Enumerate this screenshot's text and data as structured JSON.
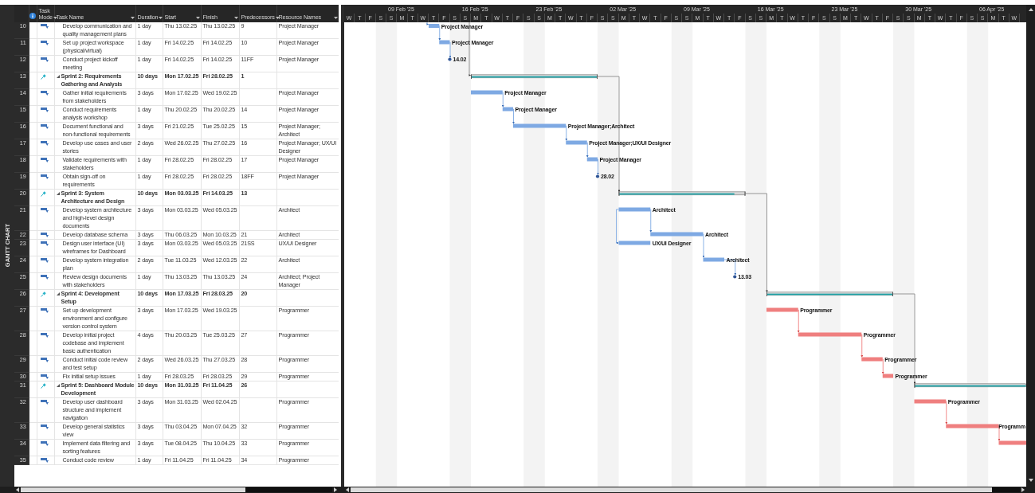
{
  "view_bar": {
    "label": "GANTT CHART"
  },
  "columns": [
    {
      "kind": "info"
    },
    {
      "kind": "text",
      "label": "Task Mode"
    },
    {
      "kind": "text",
      "label": "Task Name"
    },
    {
      "kind": "text",
      "label": "Duration"
    },
    {
      "kind": "text",
      "label": "Start"
    },
    {
      "kind": "text",
      "label": "Finish"
    },
    {
      "kind": "text",
      "label": "Predecessors"
    },
    {
      "kind": "text",
      "label": "Resource Names"
    }
  ],
  "timeline": {
    "weeks": [
      "09 Feb '25",
      "16 Feb '25",
      "23 Feb '25",
      "02 Mar '25",
      "09 Mar '25",
      "16 Mar '25",
      "23 Mar '25",
      "30 Mar '25",
      "06 Apr '25"
    ],
    "days": [
      {
        "letter": "W",
        "weekend": false
      },
      {
        "letter": "T",
        "weekend": false
      },
      {
        "letter": "F",
        "weekend": false
      },
      {
        "letter": "S",
        "weekend": true
      },
      {
        "letter": "S",
        "weekend": true
      },
      {
        "letter": "M",
        "weekend": false
      },
      {
        "letter": "T",
        "weekend": false
      },
      {
        "letter": "W",
        "weekend": false
      },
      {
        "letter": "T",
        "weekend": false
      },
      {
        "letter": "F",
        "weekend": false
      },
      {
        "letter": "S",
        "weekend": true
      },
      {
        "letter": "S",
        "weekend": true
      },
      {
        "letter": "M",
        "weekend": false
      },
      {
        "letter": "T",
        "weekend": false
      },
      {
        "letter": "W",
        "weekend": false
      },
      {
        "letter": "T",
        "weekend": false
      },
      {
        "letter": "F",
        "weekend": false
      },
      {
        "letter": "S",
        "weekend": true
      },
      {
        "letter": "S",
        "weekend": true
      },
      {
        "letter": "M",
        "weekend": false
      },
      {
        "letter": "T",
        "weekend": false
      },
      {
        "letter": "W",
        "weekend": false
      },
      {
        "letter": "T",
        "weekend": false
      },
      {
        "letter": "F",
        "weekend": false
      },
      {
        "letter": "S",
        "weekend": true
      },
      {
        "letter": "S",
        "weekend": true
      },
      {
        "letter": "M",
        "weekend": false
      },
      {
        "letter": "T",
        "weekend": false
      },
      {
        "letter": "W",
        "weekend": false
      },
      {
        "letter": "T",
        "weekend": false
      },
      {
        "letter": "F",
        "weekend": false
      },
      {
        "letter": "S",
        "weekend": true
      },
      {
        "letter": "S",
        "weekend": true
      },
      {
        "letter": "M",
        "weekend": false
      },
      {
        "letter": "T",
        "weekend": false
      },
      {
        "letter": "W",
        "weekend": false
      },
      {
        "letter": "T",
        "weekend": false
      },
      {
        "letter": "F",
        "weekend": false
      },
      {
        "letter": "S",
        "weekend": true
      },
      {
        "letter": "S",
        "weekend": true
      },
      {
        "letter": "M",
        "weekend": false
      },
      {
        "letter": "T",
        "weekend": false
      },
      {
        "letter": "W",
        "weekend": false
      },
      {
        "letter": "T",
        "weekend": false
      },
      {
        "letter": "F",
        "weekend": false
      },
      {
        "letter": "S",
        "weekend": true
      },
      {
        "letter": "S",
        "weekend": true
      },
      {
        "letter": "M",
        "weekend": false
      },
      {
        "letter": "T",
        "weekend": false
      },
      {
        "letter": "W",
        "weekend": false
      },
      {
        "letter": "T",
        "weekend": false
      },
      {
        "letter": "F",
        "weekend": false
      },
      {
        "letter": "S",
        "weekend": true
      },
      {
        "letter": "S",
        "weekend": true
      },
      {
        "letter": "M",
        "weekend": false
      },
      {
        "letter": "T",
        "weekend": false
      },
      {
        "letter": "W",
        "weekend": false
      },
      {
        "letter": "T",
        "weekend": false
      },
      {
        "letter": "F",
        "weekend": false
      },
      {
        "letter": "S",
        "weekend": true
      },
      {
        "letter": "S",
        "weekend": true
      },
      {
        "letter": "M",
        "weekend": false
      },
      {
        "letter": "T",
        "weekend": false
      },
      {
        "letter": "W",
        "weekend": false
      }
    ]
  },
  "rows": [
    {
      "id": "10",
      "kind": "task",
      "name": "Develop communication and quality management plans",
      "duration": "1 day",
      "start": "Thu 13.02.25",
      "finish": "Thu 13.02.25",
      "predecessors": "9",
      "resources": "Project Manager",
      "bar": {
        "kind": "task",
        "critical": false,
        "label": "Project Manager"
      }
    },
    {
      "id": "11",
      "kind": "task",
      "name": "Set up project workspace (physical/virtual)",
      "duration": "1 day",
      "start": "Fri 14.02.25",
      "finish": "Fri 14.02.25",
      "predecessors": "10",
      "resources": "Project Manager",
      "bar": {
        "kind": "task",
        "critical": false,
        "label": "Project Manager"
      }
    },
    {
      "id": "12",
      "kind": "task",
      "name": "Conduct project kickoff meeting",
      "duration": "1 day",
      "start": "Fri 14.02.25",
      "finish": "Fri 14.02.25",
      "predecessors": "11FF",
      "resources": "Project Manager",
      "bar": {
        "kind": "milestone",
        "label": "14.02"
      }
    },
    {
      "id": "13",
      "kind": "summary",
      "expanded": true,
      "name": "Sprint 2: Requirements Gathering and Analysis",
      "duration": "10 days",
      "start": "Mon 17.02.25",
      "finish": "Fri 28.02.25",
      "predecessors": "1",
      "bar": {
        "kind": "summary"
      }
    },
    {
      "id": "14",
      "kind": "task",
      "name": "Gather initial requirements from stakeholders",
      "duration": "3 days",
      "start": "Mon 17.02.25",
      "finish": "Wed 19.02.25",
      "resources": "Project Manager",
      "bar": {
        "kind": "task",
        "critical": false,
        "label": "Project Manager"
      }
    },
    {
      "id": "15",
      "kind": "task",
      "name": "Conduct requirements analysis workshop",
      "duration": "1 day",
      "start": "Thu 20.02.25",
      "finish": "Thu 20.02.25",
      "predecessors": "14",
      "resources": "Project Manager",
      "bar": {
        "kind": "task",
        "critical": false,
        "label": "Project Manager"
      }
    },
    {
      "id": "16",
      "kind": "task",
      "name": "Document functional and non-functional requirements",
      "duration": "3 days",
      "start": "Fri 21.02.25",
      "finish": "Tue 25.02.25",
      "predecessors": "15",
      "resources": "Project Manager; Architect",
      "bar": {
        "kind": "task",
        "critical": false,
        "label": "Project Manager;Architect"
      }
    },
    {
      "id": "17",
      "kind": "task",
      "name": "Develop use cases and user stories",
      "duration": "2 days",
      "start": "Wed 26.02.25",
      "finish": "Thu 27.02.25",
      "predecessors": "16",
      "resources": "Project Manager; UX/UI Designer",
      "bar": {
        "kind": "task",
        "critical": false,
        "label": "Project Manager;UX/UI Designer"
      }
    },
    {
      "id": "18",
      "kind": "task",
      "name": "Validate requirements with stakeholders",
      "duration": "1 day",
      "start": "Fri 28.02.25",
      "finish": "Fri 28.02.25",
      "predecessors": "17",
      "resources": "Project Manager",
      "bar": {
        "kind": "task",
        "critical": false,
        "label": "Project Manager"
      }
    },
    {
      "id": "19",
      "kind": "task",
      "name": "Obtain sign-off on requirements",
      "duration": "1 day",
      "start": "Fri 28.02.25",
      "finish": "Fri 28.02.25",
      "predecessors": "18FF",
      "resources": "Project Manager",
      "bar": {
        "kind": "milestone",
        "label": "28.02"
      }
    },
    {
      "id": "20",
      "kind": "summary",
      "expanded": true,
      "name": "Sprint 3: System Architecture and Design",
      "duration": "10 days",
      "start": "Mon 03.03.25",
      "finish": "Fri 14.03.25",
      "predecessors": "13",
      "bar": {
        "kind": "summary"
      }
    },
    {
      "id": "21",
      "kind": "task",
      "name": "Develop system architecture and high-level design documents",
      "duration": "3 days",
      "start": "Mon 03.03.25",
      "finish": "Wed 05.03.25",
      "resources": "Architect",
      "bar": {
        "kind": "task",
        "critical": false,
        "label": "Architect"
      }
    },
    {
      "id": "22",
      "kind": "task",
      "name": "Develop database schema",
      "duration": "3 days",
      "start": "Thu 06.03.25",
      "finish": "Mon 10.03.25",
      "predecessors": "21",
      "resources": "Architect",
      "bar": {
        "kind": "task",
        "critical": false,
        "label": "Architect"
      }
    },
    {
      "id": "23",
      "kind": "task",
      "name": "Design user interface (UI) wireframes for Dashboard",
      "duration": "3 days",
      "start": "Mon 03.03.25",
      "finish": "Wed 05.03.25",
      "predecessors": "21SS",
      "resources": "UX/UI Designer",
      "bar": {
        "kind": "task",
        "critical": false,
        "label": "UX/UI Designer"
      }
    },
    {
      "id": "24",
      "kind": "task",
      "name": "Develop system integration plan",
      "duration": "2 days",
      "start": "Tue 11.03.25",
      "finish": "Wed 12.03.25",
      "predecessors": "22",
      "resources": "Architect",
      "bar": {
        "kind": "task",
        "critical": false,
        "label": "Architect"
      }
    },
    {
      "id": "25",
      "kind": "task",
      "name": "Review design documents with stakeholders",
      "duration": "1 day",
      "start": "Thu 13.03.25",
      "finish": "Thu 13.03.25",
      "predecessors": "24",
      "resources": "Architect; Project Manager",
      "bar": {
        "kind": "milestone",
        "label": "13.03"
      }
    },
    {
      "id": "26",
      "kind": "summary",
      "expanded": true,
      "name": "Sprint 4: Development Setup",
      "duration": "10 days",
      "start": "Mon 17.03.25",
      "finish": "Fri 28.03.25",
      "predecessors": "20",
      "bar": {
        "kind": "summary"
      }
    },
    {
      "id": "27",
      "kind": "task",
      "name": "Set up development environment and configure version control system",
      "duration": "3 days",
      "start": "Mon 17.03.25",
      "finish": "Wed 19.03.25",
      "resources": "Programmer",
      "bar": {
        "kind": "task",
        "critical": true,
        "label": "Programmer"
      }
    },
    {
      "id": "28",
      "kind": "task",
      "name": "Develop initial project codebase and implement basic authentication",
      "duration": "4 days",
      "start": "Thu 20.03.25",
      "finish": "Tue 25.03.25",
      "predecessors": "27",
      "resources": "Programmer",
      "bar": {
        "kind": "task",
        "critical": true,
        "label": "Programmer"
      }
    },
    {
      "id": "29",
      "kind": "task",
      "name": "Conduct initial code review and test setup",
      "duration": "2 days",
      "start": "Wed 26.03.25",
      "finish": "Thu 27.03.25",
      "predecessors": "28",
      "resources": "Programmer",
      "bar": {
        "kind": "task",
        "critical": true,
        "label": "Programmer"
      }
    },
    {
      "id": "30",
      "kind": "task",
      "name": "Fix initial setup issues",
      "duration": "1 day",
      "start": "Fri 28.03.25",
      "finish": "Fri 28.03.25",
      "predecessors": "29",
      "resources": "Programmer",
      "bar": {
        "kind": "task",
        "critical": true,
        "label": "Programmer"
      }
    },
    {
      "id": "31",
      "kind": "summary",
      "expanded": true,
      "name": "Sprint 5: Dashboard Module Development",
      "duration": "10 days",
      "start": "Mon 31.03.25",
      "finish": "Fri 11.04.25",
      "predecessors": "26",
      "bar": {
        "kind": "summary"
      }
    },
    {
      "id": "32",
      "kind": "task",
      "name": "Develop user dashboard structure and implement navigation",
      "duration": "3 days",
      "start": "Mon 31.03.25",
      "finish": "Wed 02.04.25",
      "resources": "Programmer",
      "bar": {
        "kind": "task",
        "critical": true,
        "label": "Programmer"
      }
    },
    {
      "id": "33",
      "kind": "task",
      "name": "Develop general statistics view",
      "duration": "3 days",
      "start": "Thu 03.04.25",
      "finish": "Mon 07.04.25",
      "predecessors": "32",
      "resources": "Programmer",
      "bar": {
        "kind": "task",
        "critical": true,
        "label": "Programm"
      }
    },
    {
      "id": "34",
      "kind": "task",
      "name": "Implement data filtering and sorting features",
      "duration": "3 days",
      "start": "Tue 08.04.25",
      "finish": "Thu 10.04.25",
      "predecessors": "33",
      "resources": "Programmer",
      "bar": {
        "kind": "task",
        "critical": true
      }
    },
    {
      "id": "35",
      "kind": "task",
      "name": "Conduct code review",
      "duration": "1 day",
      "start": "Fri 11.04.25",
      "finish": "Fri 11.04.25",
      "predecessors": "34",
      "resources": "Programmer"
    }
  ]
}
